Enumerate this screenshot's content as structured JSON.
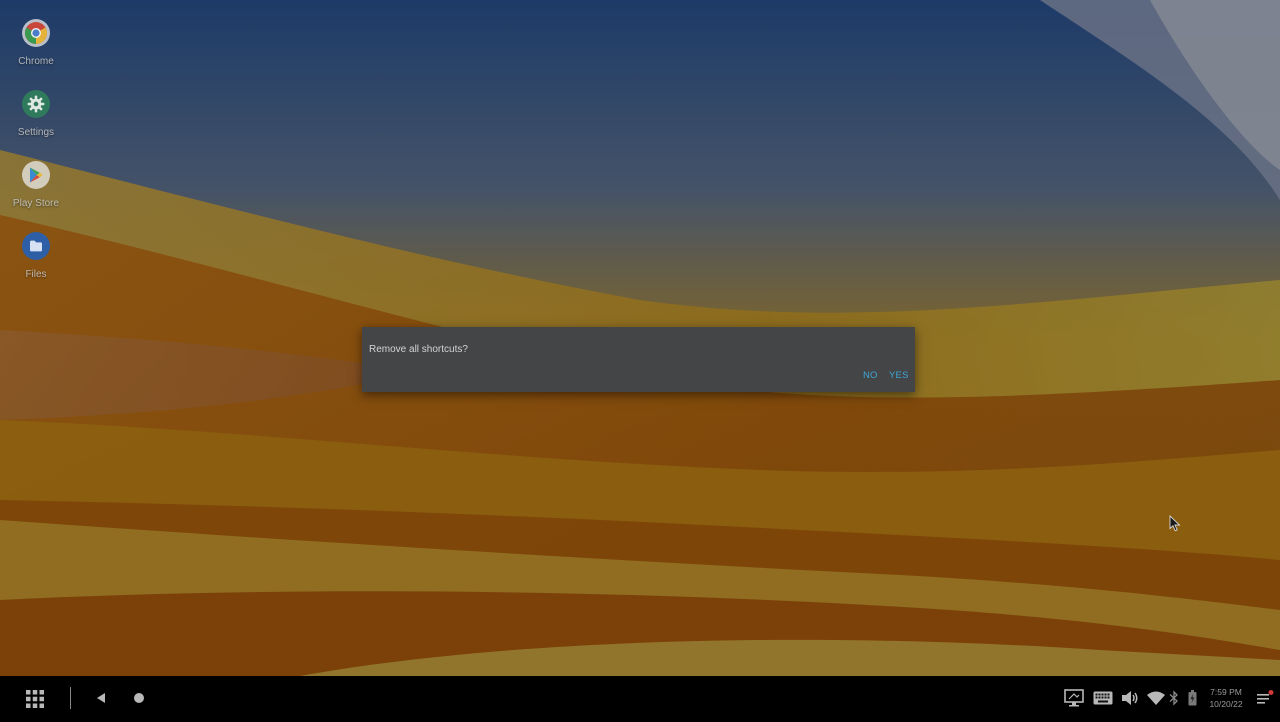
{
  "desktop": {
    "icons": [
      {
        "name": "chrome-icon",
        "label": "Chrome"
      },
      {
        "name": "settings-icon",
        "label": "Settings"
      },
      {
        "name": "play-store-icon",
        "label": "Play Store"
      },
      {
        "name": "files-icon",
        "label": "Files"
      }
    ]
  },
  "dialog": {
    "message": "Remove all shortcuts?",
    "no_label": "NO",
    "yes_label": "YES",
    "button_color": "#3fa7d6"
  },
  "taskbar": {
    "left_icons": [
      "app-drawer-icon",
      "back-icon",
      "home-icon"
    ],
    "tray_icons": [
      "display-icon",
      "keyboard-icon",
      "volume-icon",
      "wifi-icon",
      "bluetooth-icon",
      "battery-icon",
      "notifications-icon"
    ],
    "time": "7:59 PM",
    "date": "10/20/22"
  }
}
